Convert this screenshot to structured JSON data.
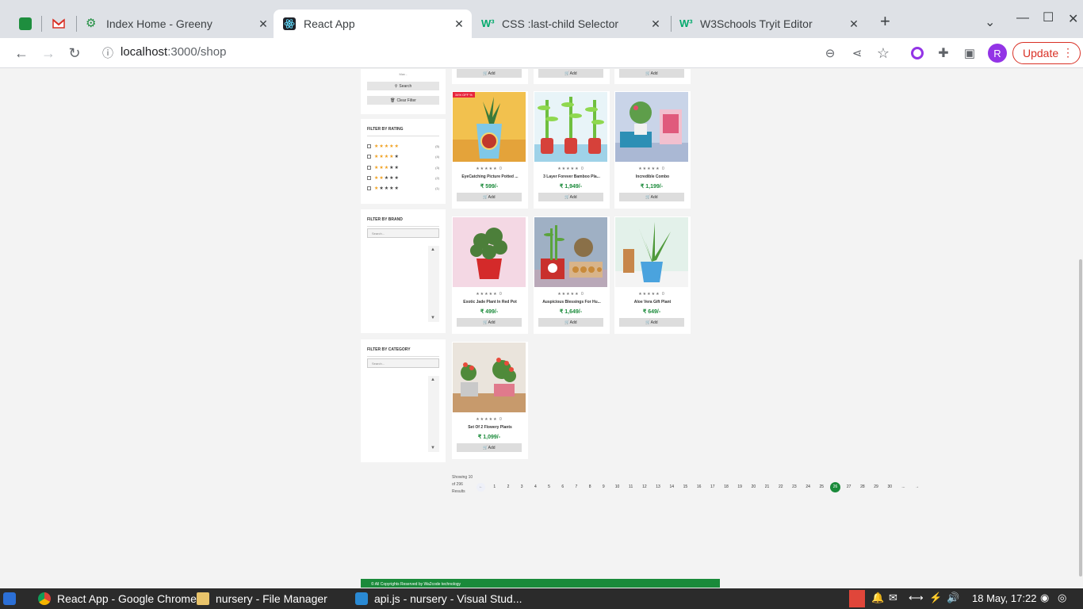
{
  "browser": {
    "tabs": [
      {
        "title": "",
        "icon": "chat-icon"
      },
      {
        "title": "",
        "icon": "gmail-icon"
      },
      {
        "title": "Index Home - Greeny",
        "icon": "gear-icon"
      },
      {
        "title": "React App",
        "icon": "react-icon"
      },
      {
        "title": "CSS :last-child Selector",
        "icon": "w3schools-icon"
      },
      {
        "title": "W3Schools Tryit Editor",
        "icon": "w3schools-icon"
      }
    ],
    "url_host": "localhost",
    "url_path": ":3000/shop",
    "profile_initial": "R",
    "update_label": "Update"
  },
  "sidebar": {
    "price": {
      "max_placeholder": "Max -",
      "search_label": "Search",
      "clear_label": "Clear Filter"
    },
    "rating": {
      "heading": "FILTER BY RATING",
      "rows": [
        {
          "stars": 5,
          "count": "(5)"
        },
        {
          "stars": 4,
          "count": "(4)"
        },
        {
          "stars": 3,
          "count": "(3)"
        },
        {
          "stars": 2,
          "count": "(2)"
        },
        {
          "stars": 1,
          "count": "(1)"
        }
      ]
    },
    "brand": {
      "heading": "FILTER BY BRAND",
      "search_placeholder": "Search..."
    },
    "category": {
      "heading": "FILTER BY CATEGORY",
      "search_placeholder": "Search..."
    }
  },
  "products": {
    "add_label": "Add",
    "rating_text": "★★★★★ 0",
    "items": [
      {
        "name": "EyeCatching Picture Potted ...",
        "price": "₹ 599/-",
        "badge": "34% OFF %"
      },
      {
        "name": "3 Layer Forever Bamboo Pla...",
        "price": "₹ 1,949/-"
      },
      {
        "name": "Incredible Combo",
        "price": "₹ 1,199/-"
      },
      {
        "name": "Exotic Jade Plant In Red Pot",
        "price": "₹ 499/-"
      },
      {
        "name": "Auspicious Blessings For Hu...",
        "price": "₹ 1,649/-"
      },
      {
        "name": "Aloe Vera Gift Plant",
        "price": "₹ 649/-"
      },
      {
        "name": "Set Of 2 Flowery Plants",
        "price": "₹ 1,099/-"
      }
    ]
  },
  "pagination": {
    "showing_text": "Showing 10 of 296 Results",
    "prev": "←",
    "next": "→",
    "ellipsis": "...",
    "current": "26",
    "pages": [
      "1",
      "2",
      "3",
      "4",
      "5",
      "6",
      "7",
      "8",
      "9",
      "10",
      "11",
      "12",
      "13",
      "14",
      "15",
      "16",
      "17",
      "18",
      "19",
      "20",
      "21",
      "22",
      "23",
      "24",
      "25",
      "26",
      "27",
      "28",
      "29",
      "30"
    ]
  },
  "footer": {
    "text": "© All Copyrights Reserved by Wa2code technology"
  },
  "taskbar": {
    "items": [
      {
        "label": "React App - Google Chrome"
      },
      {
        "label": "nursery - File Manager"
      },
      {
        "label": "api.js - nursery - Visual Stud..."
      }
    ],
    "clock": "18 May, 17:22"
  },
  "colors": {
    "accent_green": "#1a8a3a",
    "update_red": "#d93025",
    "badge_red": "#e8263c"
  }
}
